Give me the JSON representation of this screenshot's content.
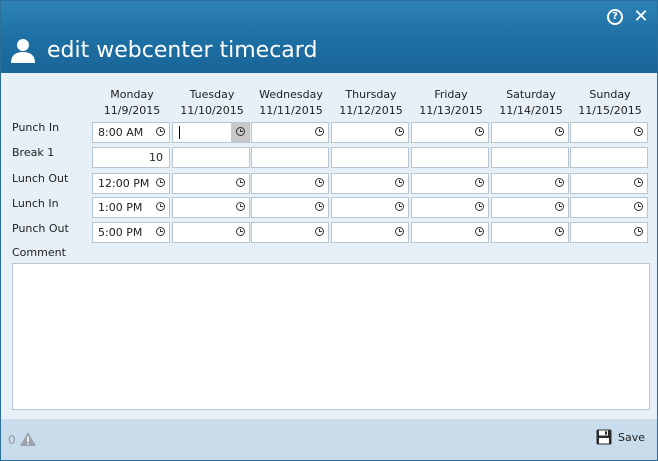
{
  "window": {
    "title": "edit webcenter timecard",
    "help_icon": "help-icon",
    "close_icon": "close-icon"
  },
  "days": [
    {
      "name": "Monday",
      "date": "11/9/2015"
    },
    {
      "name": "Tuesday",
      "date": "11/10/2015"
    },
    {
      "name": "Wednesday",
      "date": "11/11/2015"
    },
    {
      "name": "Thursday",
      "date": "11/12/2015"
    },
    {
      "name": "Friday",
      "date": "11/13/2015"
    },
    {
      "name": "Saturday",
      "date": "11/14/2015"
    },
    {
      "name": "Sunday",
      "date": "11/15/2015"
    }
  ],
  "rows": {
    "punch_in": {
      "label": "Punch In",
      "values": [
        "8:00 AM",
        "",
        "",
        "",
        "",
        "",
        ""
      ]
    },
    "break_1": {
      "label": "Break 1",
      "values": [
        "10",
        "",
        "",
        "",
        "",
        "",
        ""
      ]
    },
    "lunch_out": {
      "label": "Lunch Out",
      "values": [
        "12:00 PM",
        "",
        "",
        "",
        "",
        "",
        ""
      ]
    },
    "lunch_in": {
      "label": "Lunch In",
      "values": [
        "1:00 PM",
        "",
        "",
        "",
        "",
        "",
        ""
      ]
    },
    "punch_out": {
      "label": "Punch Out",
      "values": [
        "5:00 PM",
        "",
        "",
        "",
        "",
        "",
        ""
      ]
    }
  },
  "comment": {
    "label": "Comment",
    "value": ""
  },
  "footer": {
    "warning_count": "0",
    "save_label": "Save"
  },
  "colors": {
    "title_bar": "#1d6fa3",
    "content_bg": "#e7f0f7",
    "footer_bg": "#c8dceb"
  }
}
